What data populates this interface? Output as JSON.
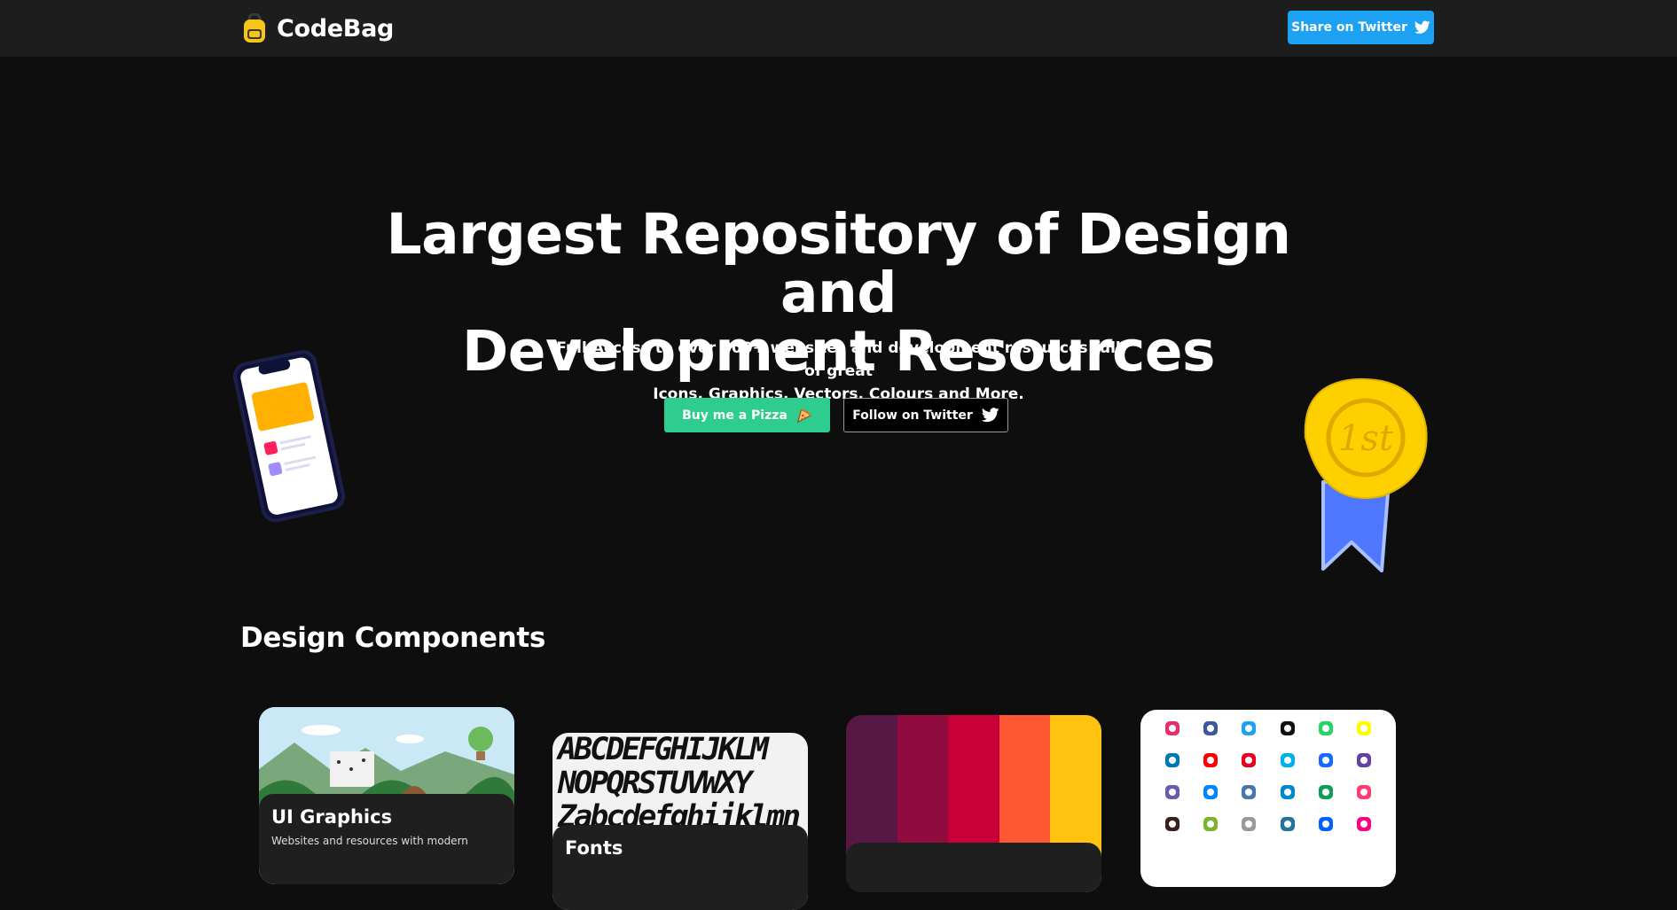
{
  "header": {
    "brand": "CodeBag",
    "share_button": "Share on Twitter"
  },
  "hero": {
    "title_line1": "Largest Repository of Design and",
    "title_line2": "Development Resources",
    "subtitle_line1": "Full Access to over 800+ websites and development resources full of great",
    "subtitle_line2": "Icons, Graphics, Vectors, Colours and More.",
    "pizza_button": "Buy me a Pizza",
    "follow_button": "Follow on Twitter",
    "medal_text": "1st"
  },
  "section": {
    "title": "Design Components"
  },
  "cards": {
    "ui_graphics": {
      "title": "UI Graphics",
      "desc": "Websites and resources with modern"
    },
    "fonts": {
      "title": "Fonts",
      "sample_line1": "ABCDEFGHIJKLM",
      "sample_line2": "NOPQRSTUVWXY",
      "sample_line3": "Zabcdefghijklmn"
    },
    "colors": {
      "swatches": [
        "#571845",
        "#900c3e",
        "#c70039",
        "#ff5733",
        "#ffc30f"
      ]
    },
    "icons": {
      "items": [
        "instagram-icon",
        "facebook-icon",
        "twitter-icon",
        "tiktok-icon",
        "whatsapp-icon",
        "snapchat-icon",
        "linkedin-icon",
        "youtube-icon",
        "pinterest-icon",
        "skype-icon",
        "behance-icon",
        "twitch-icon",
        "viber-icon",
        "messenger-icon",
        "vk-icon",
        "telegram-icon",
        "hangouts-icon",
        "tinder-icon",
        "kakaotalk-icon",
        "wechat-icon",
        "imessage-icon",
        "wordpress-icon",
        "dropbox-icon",
        "flickr-icon"
      ],
      "colors": [
        "#e1306c",
        "#3b5998",
        "#1da1f2",
        "#111111",
        "#25d366",
        "#fffc00",
        "#0077b5",
        "#ff0000",
        "#e60023",
        "#00aff0",
        "#1769ff",
        "#6441a5",
        "#665cac",
        "#0084ff",
        "#4a76a8",
        "#0088cc",
        "#0f9d58",
        "#fe3c72",
        "#3c1e1e",
        "#7bb32e",
        "#999999",
        "#21759b",
        "#0061ff",
        "#ff0084"
      ]
    }
  },
  "colors": {
    "twitter_blue": "#1da1f2",
    "pizza_green": "#2ecc8f",
    "background": "#0e0e0e",
    "header_bg": "#1d1d1d"
  }
}
